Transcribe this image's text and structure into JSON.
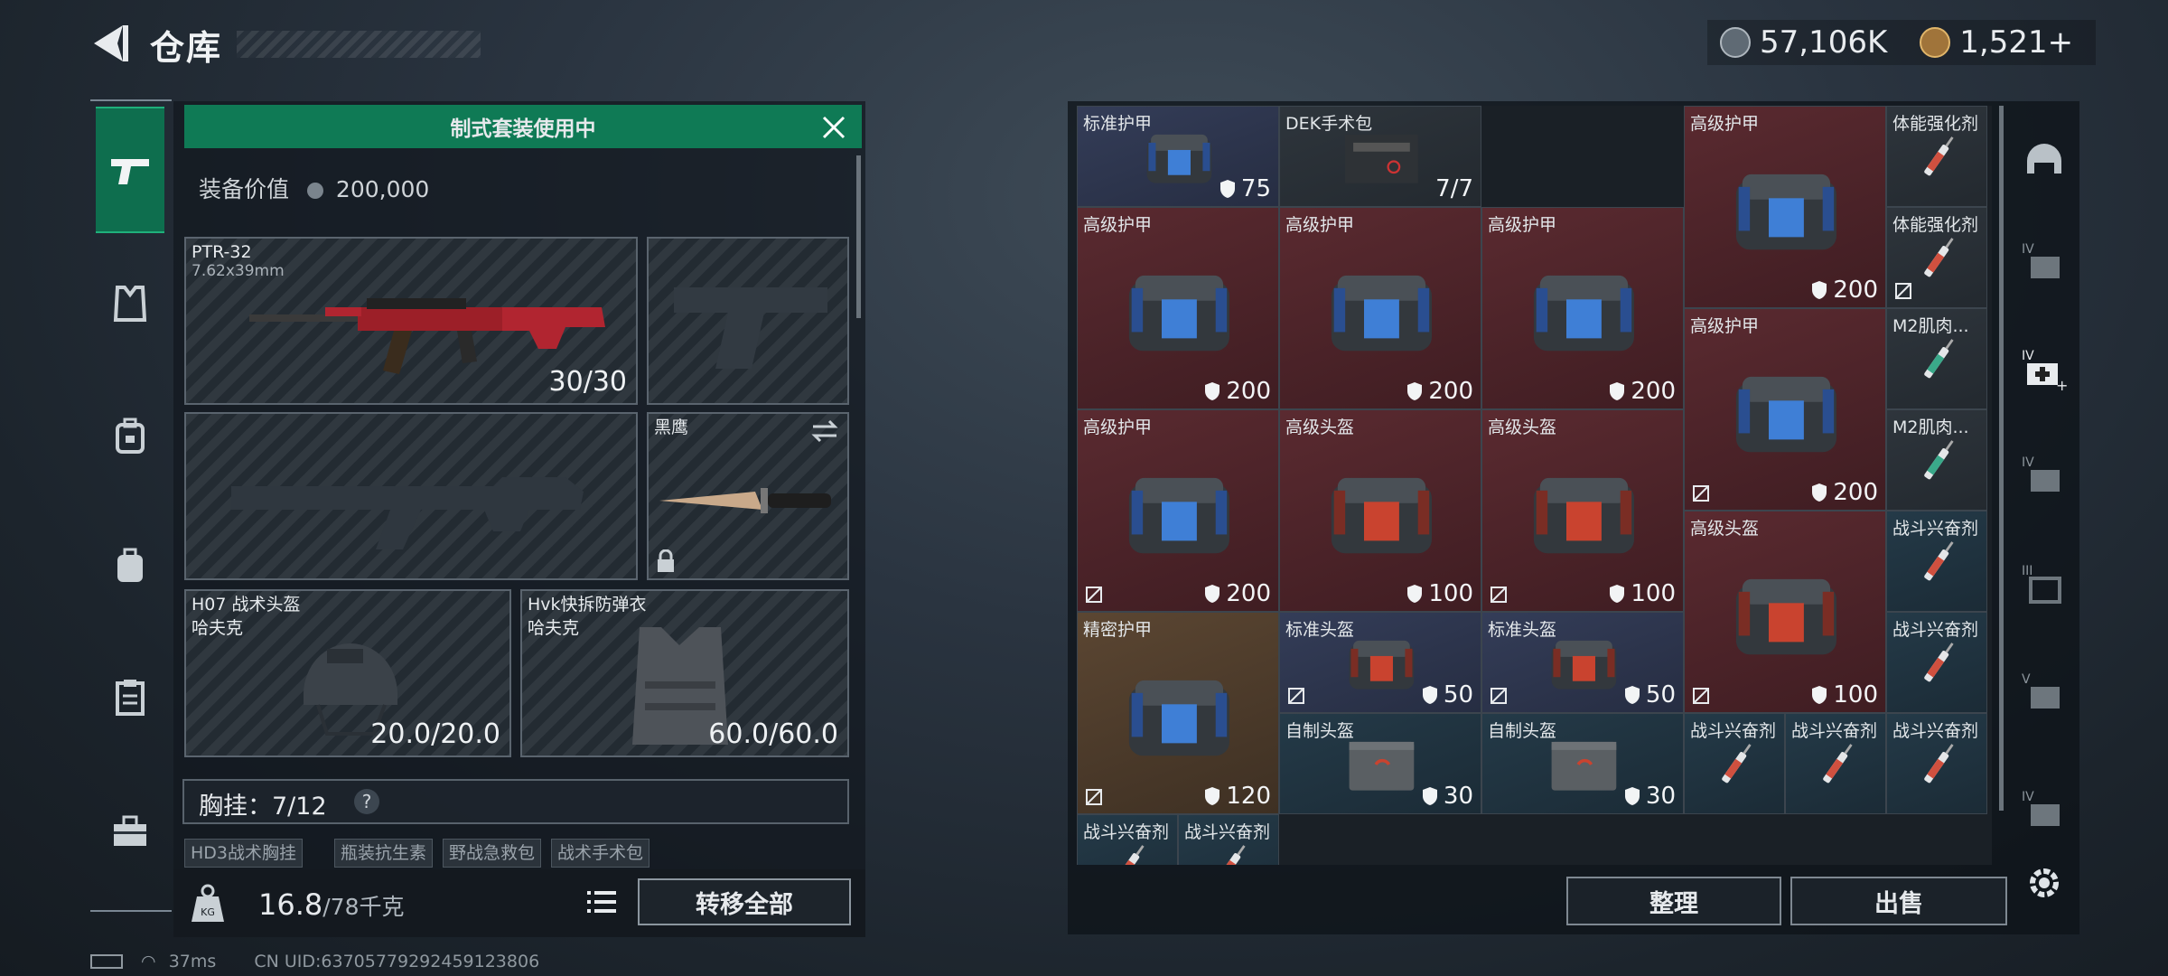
{
  "header": {
    "title": "仓库"
  },
  "currency": {
    "silver": "57,106K",
    "gold": "1,521+"
  },
  "category_tabs": [
    {
      "icon": "pistol-icon",
      "active": true
    },
    {
      "icon": "armor-icon",
      "active": false
    },
    {
      "icon": "backpack-lock-icon",
      "active": false
    },
    {
      "icon": "backpack-icon",
      "active": false
    },
    {
      "icon": "clipboard-icon",
      "active": false
    },
    {
      "icon": "toolbox-icon",
      "active": false
    }
  ],
  "loadout": {
    "banner": "制式套装使用中",
    "value_label": "装备价值",
    "value": "200,000",
    "primary": {
      "name": "PTR-32",
      "caliber": "7.62x39mm",
      "ammo": "30/30"
    },
    "melee": {
      "name": "黑鹰"
    },
    "helmet": {
      "name": "H07 战术头盔",
      "brand": "哈夫克",
      "durability": "20.0/20.0"
    },
    "vest": {
      "name": "Hvk快拆防弹衣",
      "brand": "哈夫克",
      "durability": "60.0/60.0"
    },
    "chest_rig": {
      "label": "胸挂：",
      "count": "7/12",
      "help": "?"
    },
    "chest_items": [
      "HD3战术胸挂",
      "瓶装抗生素",
      "野战急救包",
      "战术手术包"
    ],
    "weight": {
      "current": "16.8",
      "max": "/78千克"
    },
    "transfer_all": "转移全部"
  },
  "inventory": {
    "items": [
      {
        "name": "标准护甲",
        "value": "75",
        "color": "blue"
      },
      {
        "name": "DEK手术包",
        "value": "7/7",
        "color": "gray"
      },
      {
        "name": "高级护甲",
        "value": "200",
        "color": "red"
      },
      {
        "name": "体能强化剂",
        "value": "",
        "color": "gray"
      },
      {
        "name": "高级护甲",
        "value": "200",
        "color": "red"
      },
      {
        "name": "高级护甲",
        "value": "200",
        "color": "red"
      },
      {
        "name": "高级护甲",
        "value": "200",
        "color": "red"
      },
      {
        "name": "体能强化剂",
        "value": "",
        "color": "gray"
      },
      {
        "name": "高级护甲",
        "value": "200",
        "color": "red"
      },
      {
        "name": "M2肌肉...",
        "value": "",
        "color": "gray"
      },
      {
        "name": "高级护甲",
        "value": "200",
        "color": "red"
      },
      {
        "name": "高级头盔",
        "value": "100",
        "color": "red"
      },
      {
        "name": "高级头盔",
        "value": "100",
        "color": "red"
      },
      {
        "name": "M2肌肉...",
        "value": "",
        "color": "gray"
      },
      {
        "name": "高级头盔",
        "value": "100",
        "color": "red"
      },
      {
        "name": "战斗兴奋剂",
        "value": "",
        "color": "teal"
      },
      {
        "name": "精密护甲",
        "value": "120",
        "color": "brown"
      },
      {
        "name": "标准头盔",
        "value": "50",
        "color": "blue"
      },
      {
        "name": "标准头盔",
        "value": "50",
        "color": "blue"
      },
      {
        "name": "战斗兴奋剂",
        "value": "",
        "color": "teal"
      },
      {
        "name": "自制头盔",
        "value": "30",
        "color": "teal"
      },
      {
        "name": "自制头盔",
        "value": "30",
        "color": "teal"
      },
      {
        "name": "战斗兴奋剂",
        "value": "",
        "color": "teal"
      },
      {
        "name": "战斗兴奋剂",
        "value": "",
        "color": "teal"
      },
      {
        "name": "战斗兴奋剂",
        "value": "",
        "color": "teal"
      },
      {
        "name": "战斗兴奋剂",
        "value": "",
        "color": "teal"
      },
      {
        "name": "战斗兴奋剂",
        "value": "",
        "color": "teal"
      }
    ],
    "sort": "整理",
    "sell": "出售"
  },
  "right_rail": [
    "helmet-icon",
    "vest-IV-icon",
    "medkit-IV-add-icon",
    "vest-IV-icon",
    "armor-III-icon",
    "vest-V-icon",
    "vest-IV-icon"
  ],
  "status": {
    "ping": "37ms",
    "uid": "CN UID:6370577929245912380​6"
  }
}
